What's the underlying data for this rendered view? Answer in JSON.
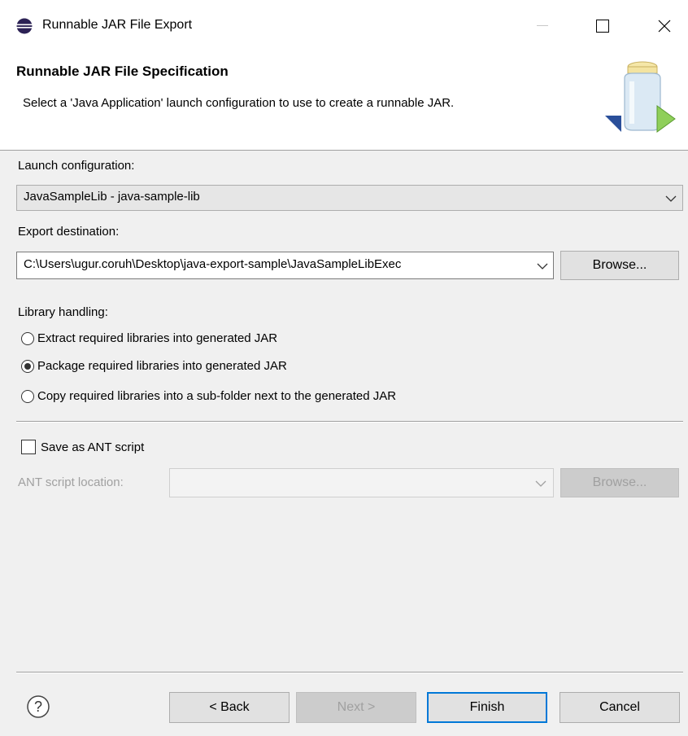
{
  "window": {
    "title": "Runnable JAR File Export",
    "minimize_glyph": "—",
    "maximize_glyph": "☐",
    "close_glyph": "✕"
  },
  "header": {
    "title": "Runnable JAR File Specification",
    "description": "Select a 'Java Application' launch configuration to use to create a runnable JAR."
  },
  "launch": {
    "label": "Launch configuration:",
    "value": "JavaSampleLib - java-sample-lib"
  },
  "export": {
    "label": "Export destination:",
    "value": "C:\\Users\\ugur.coruh\\Desktop\\java-export-sample\\JavaSampleLibExec",
    "browse_label": "Browse..."
  },
  "library": {
    "label": "Library handling:",
    "options": [
      {
        "label": "Extract required libraries into generated JAR",
        "selected": false
      },
      {
        "label": "Package required libraries into generated JAR",
        "selected": true
      },
      {
        "label": "Copy required libraries into a sub-folder next to the generated JAR",
        "selected": false
      }
    ]
  },
  "ant": {
    "save_label": "Save as ANT script",
    "save_checked": false,
    "location_label": "ANT script location:",
    "location_value": "",
    "browse_label": "Browse..."
  },
  "footer": {
    "help_glyph": "?",
    "back_label": "< Back",
    "next_label": "Next >",
    "finish_label": "Finish",
    "cancel_label": "Cancel"
  },
  "colors": {
    "accent": "#0078d7",
    "eclipse_icon": "#2c2255"
  },
  "icons": [
    "eclipse-icon",
    "jar-export-icon",
    "chevron-down-icon",
    "help-icon"
  ]
}
